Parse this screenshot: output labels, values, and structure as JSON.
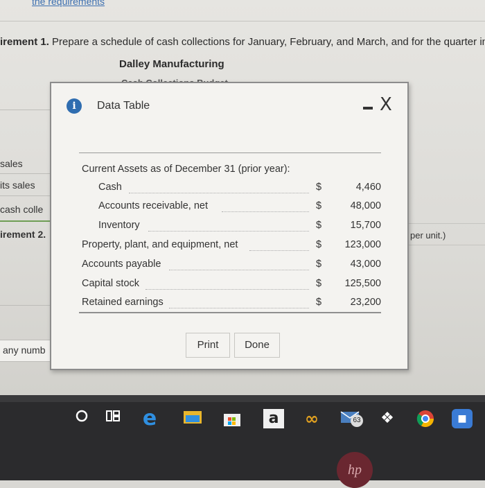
{
  "background": {
    "req_link": "the requirements",
    "requirement1_label": "irement 1.",
    "requirement1_text": " Prepare a schedule of cash collections for January, February, and March, and for the quarter in",
    "company": "Dalley Manufacturing",
    "budget_title": "Cash Collections Budget",
    "side_labels": [
      "sales",
      "its sales",
      "cash colle",
      "irement 2.",
      "any numb"
    ],
    "right_note": "per unit.)"
  },
  "dialog": {
    "title": "Data Table",
    "heading": "Current Assets as of December 31 (prior year):",
    "rows": [
      {
        "label": "Cash",
        "currency": "$",
        "value": "4,460"
      },
      {
        "label": "Accounts receivable, net",
        "currency": "$",
        "value": "48,000"
      },
      {
        "label": "Inventory",
        "currency": "$",
        "value": "15,700"
      },
      {
        "label": "Property, plant, and equipment, net",
        "currency": "$",
        "value": "123,000"
      },
      {
        "label": "Accounts payable",
        "currency": "$",
        "value": "43,000"
      },
      {
        "label": "Capital stock",
        "currency": "$",
        "value": "125,500"
      },
      {
        "label": "Retained earnings",
        "currency": "$",
        "value": "23,200"
      }
    ],
    "print_label": "Print",
    "done_label": "Done",
    "close_symbol": "X"
  },
  "taskbar": {
    "mail_badge": "63",
    "amazon_letter": "a",
    "hp_logo": "hp"
  }
}
